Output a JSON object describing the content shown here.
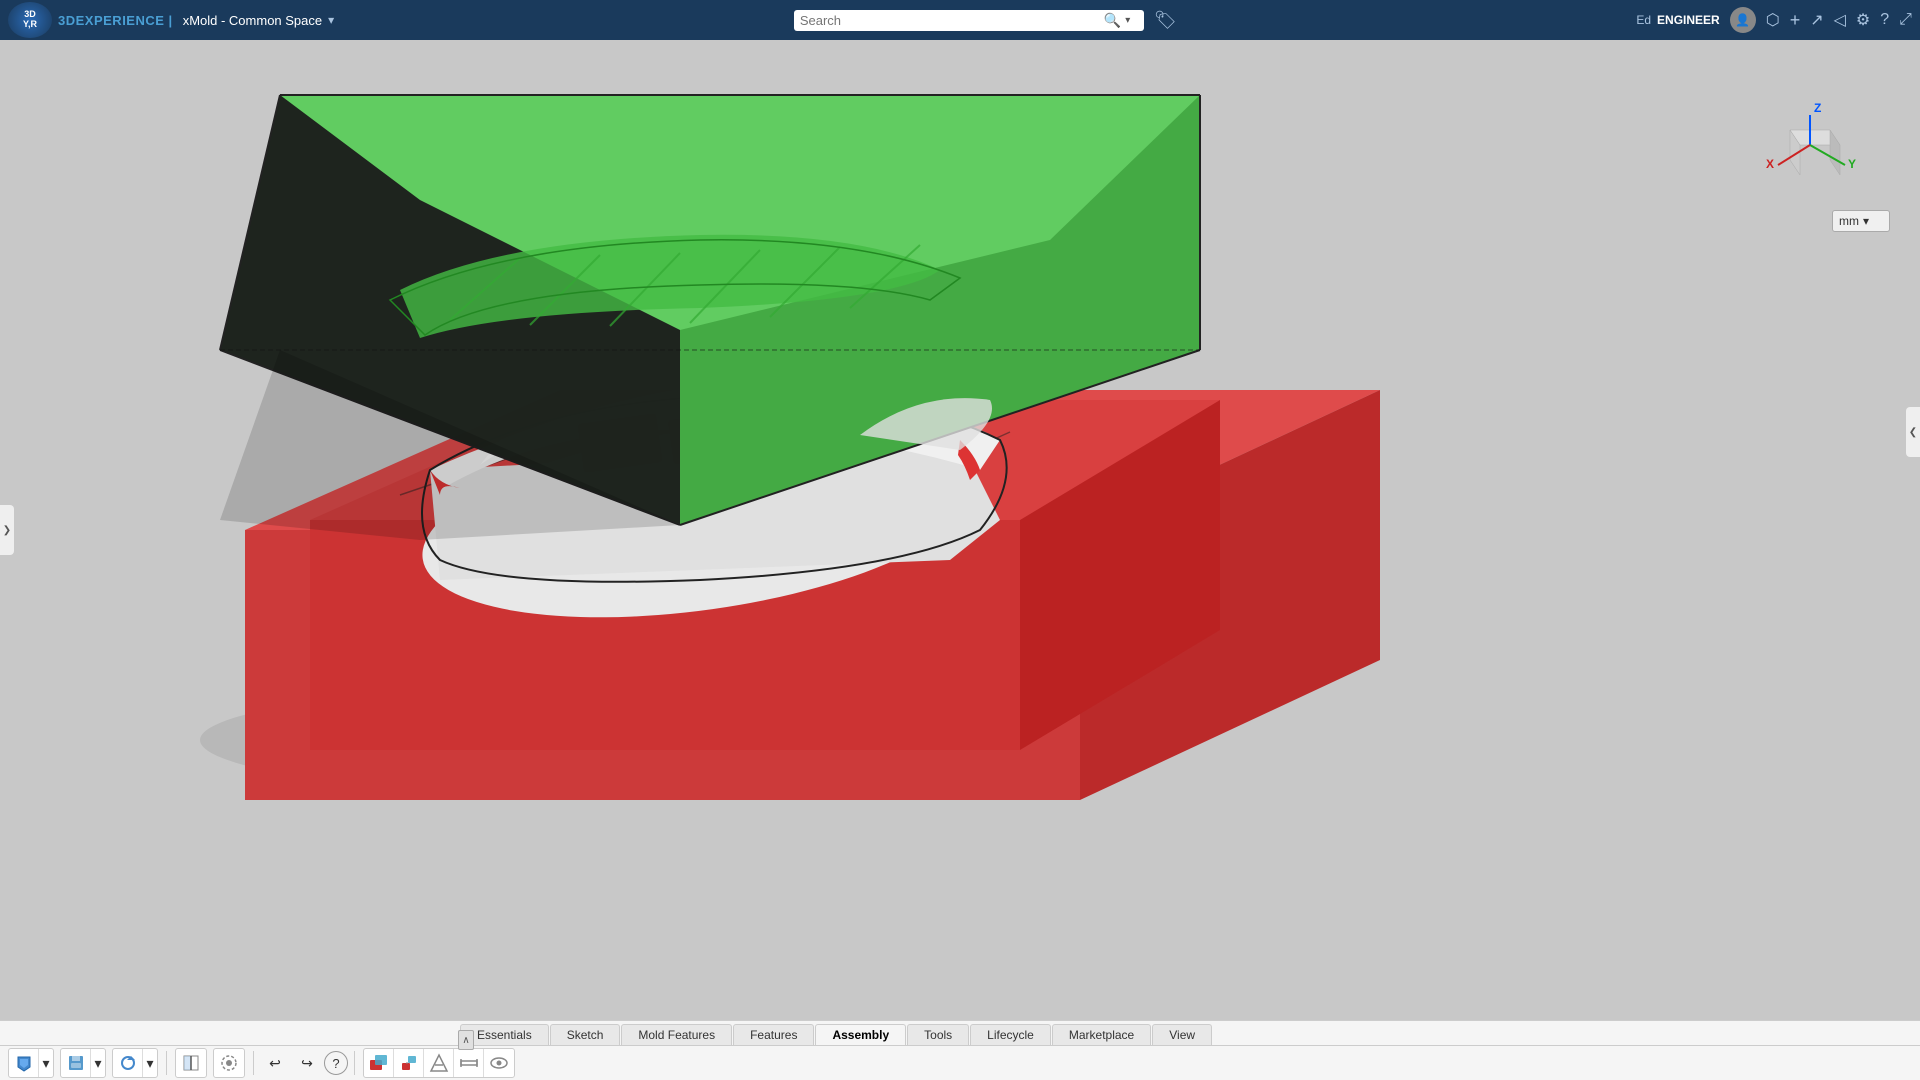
{
  "topbar": {
    "logo_line1": "3D",
    "logo_line2": "Y,R",
    "brand_prefix": "3D",
    "brand_name": "EXPERIENCE",
    "brand_separator": " | ",
    "workspace": "xMold - Common Space",
    "workspace_dropdown_icon": "▾",
    "search_placeholder": "Search",
    "user_role_prefix": "Ed ",
    "user_role": "ENGINEER",
    "icons": {
      "bookmark": "🏷",
      "notifications": "🔔",
      "add": "+",
      "share": "⬆",
      "broadcast": "📡",
      "settings": "⚙",
      "help": "?",
      "maximize": "⤢"
    }
  },
  "viewport": {
    "background_color": "#c8c8c8",
    "units": "mm",
    "units_dropdown_arrow": "▾"
  },
  "left_handle": {
    "icon": "❯"
  },
  "right_handle": {
    "icon": "❮"
  },
  "bottom_toolbar": {
    "tabs": [
      {
        "label": "Essentials",
        "active": false
      },
      {
        "label": "Sketch",
        "active": false
      },
      {
        "label": "Mold Features",
        "active": false
      },
      {
        "label": "Features",
        "active": false
      },
      {
        "label": "Assembly",
        "active": false
      },
      {
        "label": "Tools",
        "active": false
      },
      {
        "label": "Lifecycle",
        "active": false
      },
      {
        "label": "Marketplace",
        "active": false
      },
      {
        "label": "View",
        "active": false
      }
    ],
    "collapse_icon": "︿"
  }
}
